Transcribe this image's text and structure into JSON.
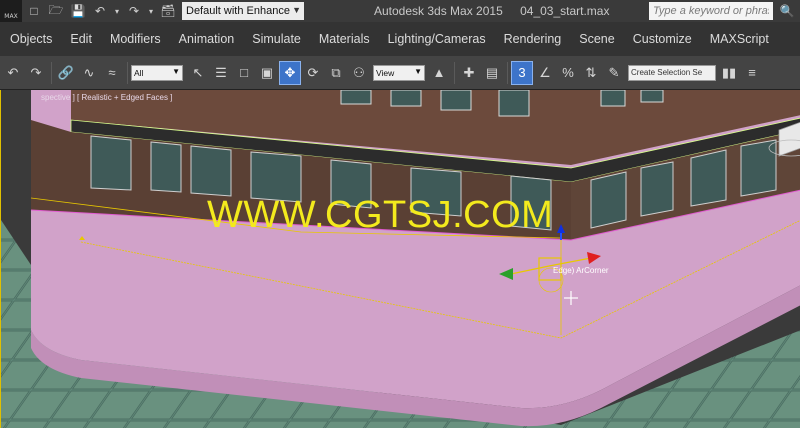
{
  "titlebar": {
    "logo_text": "MAX",
    "workspace": "Default with Enhance",
    "app_name": "Autodesk 3ds Max  2015",
    "file_name": "04_03_start.max",
    "search_placeholder": "Type a keyword or phrase"
  },
  "menu": [
    "Objects",
    "Edit",
    "Modifiers",
    "Animation",
    "Simulate",
    "Materials",
    "Lighting/Cameras",
    "Rendering",
    "Scene",
    "Customize",
    "MAXScript"
  ],
  "toolbar": {
    "selection_filter": "All",
    "reference_coord": "View",
    "snap_label": "3",
    "selection_set_placeholder": "Create Selection Se"
  },
  "viewport": {
    "label": "spective ] [ Realistic + Edged Faces ]",
    "watermark": "WWW.CGTSJ.COM",
    "selected_object": "Edge) ArCorner",
    "colors": {
      "ground": "#d1a2c9",
      "selection": "#e8c800",
      "brick": "#6c4a3c",
      "window": "#3f5a58"
    }
  }
}
